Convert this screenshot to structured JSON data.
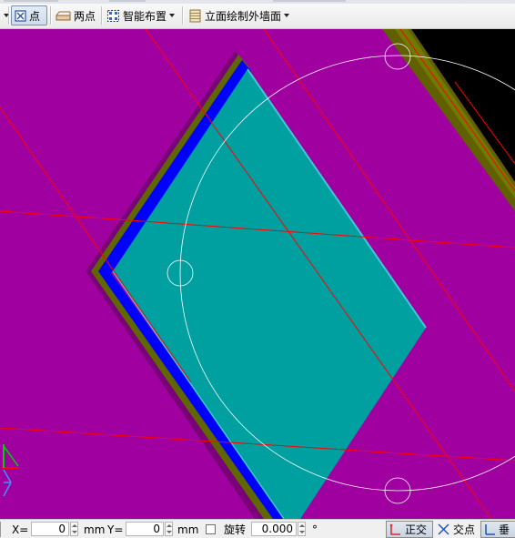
{
  "toolbar": {
    "items": [
      {
        "label": "点",
        "icon": "point-icon",
        "active": true
      },
      {
        "label": "两点",
        "icon": "two-point-icon"
      },
      {
        "label": "智能布置",
        "icon": "smart-layout-icon",
        "has_dropdown": true
      },
      {
        "label": "立面绘制外墙面",
        "icon": "elevation-wall-icon",
        "has_dropdown": true
      }
    ]
  },
  "canvas": {
    "background_color": "#a0009f",
    "slab_color": "#00a0a0",
    "slab_edge_color": "#40c0d0",
    "edge_blue_color": "#0000ff",
    "edge_olive_color": "#607000",
    "edge_shadow_color": "#800080",
    "void_color": "#000000",
    "axis_line_color": "#ff0000",
    "snap_circle_color": "#ffffff"
  },
  "statusbar": {
    "x_label": "X=",
    "x_value": "0",
    "x_unit": "mm",
    "y_label": "Y=",
    "y_value": "0",
    "y_unit": "mm",
    "rotate_label": "旋转",
    "rotate_value": "0.000",
    "degree_symbol": "°",
    "ortho_label": "正交",
    "intersection_label": "交点",
    "perpendicular_label": "垂"
  }
}
